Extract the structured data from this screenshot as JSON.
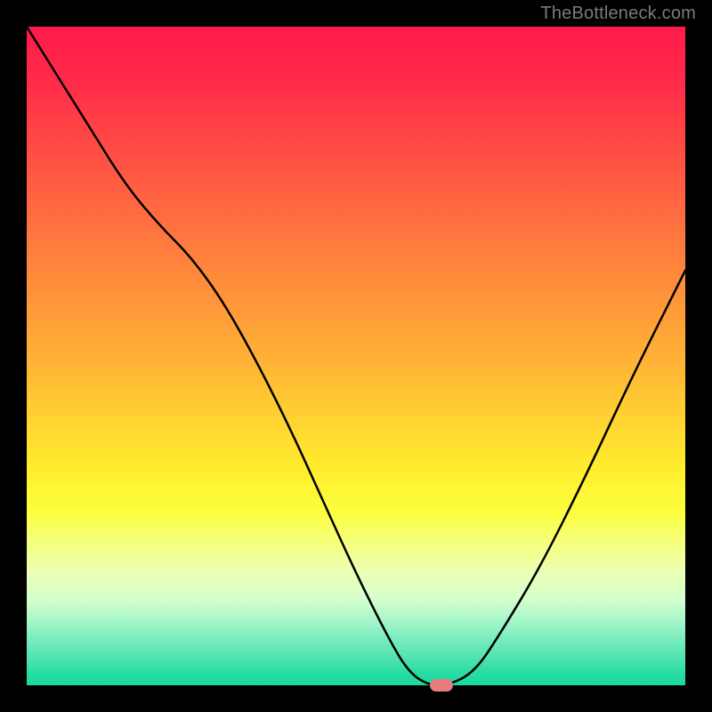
{
  "watermark": "TheBottleneck.com",
  "chart_data": {
    "type": "line",
    "title": "",
    "xlabel": "",
    "ylabel": "",
    "xlim": [
      0,
      100
    ],
    "ylim": [
      0,
      100
    ],
    "grid": false,
    "background_gradient": {
      "top_color": "#ff1a4b",
      "mid_color": "#ffd431",
      "bottom_color": "#19d99f"
    },
    "x": [
      0,
      5,
      10,
      15,
      20,
      25,
      30,
      35,
      40,
      45,
      50,
      55,
      58,
      61,
      64,
      68,
      72,
      78,
      85,
      92,
      100
    ],
    "y": [
      100,
      92,
      84,
      76,
      70,
      65,
      58,
      49,
      39,
      28,
      17,
      7,
      2,
      0,
      0,
      2,
      8,
      18,
      32,
      47,
      63
    ],
    "marker": {
      "x": 63,
      "y": 0,
      "color": "#e77c7c"
    }
  }
}
